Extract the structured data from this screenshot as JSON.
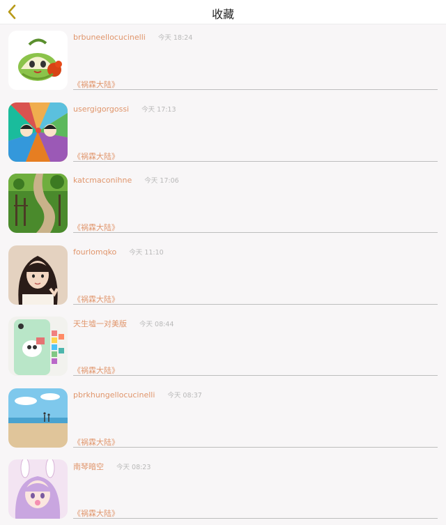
{
  "nav": {
    "title": "收藏",
    "back_icon": "chevron-left-icon",
    "accent": "#b89a18"
  },
  "favorites": [
    {
      "username": "brbuneellocucinelli",
      "time": "今天 18:24",
      "tag": "《祸霖大陆》"
    },
    {
      "username": "usergigorgossi",
      "time": "今天 17:13",
      "tag": "《祸霖大陆》"
    },
    {
      "username": "katcmaconihne",
      "time": "今天 17:06",
      "tag": "《祸霖大陆》"
    },
    {
      "username": "fourlomqko",
      "time": "今天 11:10",
      "tag": "《祸霖大陆》"
    },
    {
      "username": "天生墟一对美版",
      "time": "今天 08:44",
      "tag": "《祸霖大陆》"
    },
    {
      "username": "pbrkhungellocucinelli",
      "time": "今天 08:37",
      "tag": "《祸霖大陆》"
    },
    {
      "username": "南琴暗空",
      "time": "今天 08:23",
      "tag": "《祸霖大陆》"
    }
  ],
  "colors": {
    "name": "#e0956b",
    "time": "#b8b8b8",
    "background": "#f8f6f7"
  }
}
